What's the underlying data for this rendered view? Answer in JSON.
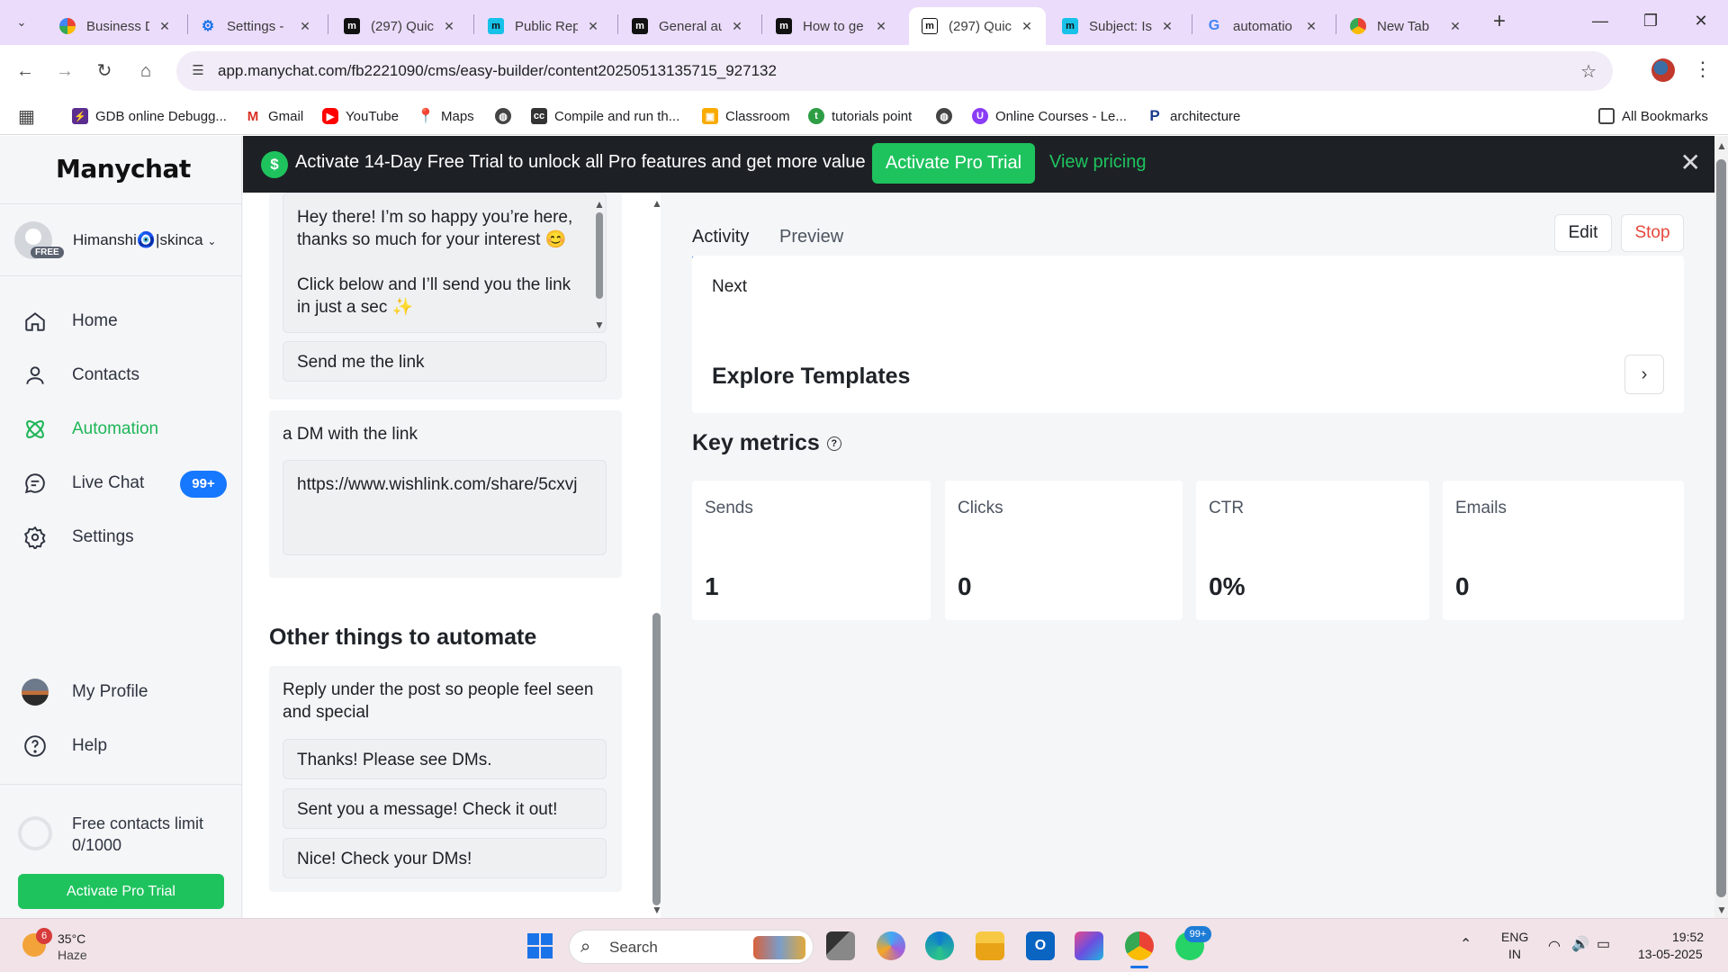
{
  "browser": {
    "tabs": [
      {
        "title": "Business D",
        "icon": "business-icon"
      },
      {
        "title": "Settings - ",
        "icon": "settings-gear-icon"
      },
      {
        "title": "(297) Quic",
        "icon": "manychat-icon"
      },
      {
        "title": "Public Rep",
        "icon": "manychat-icon"
      },
      {
        "title": "General au",
        "icon": "manychat-icon"
      },
      {
        "title": "How to ge",
        "icon": "manychat-icon"
      },
      {
        "title": "(297) Quic",
        "icon": "manychat-icon",
        "active": true
      },
      {
        "title": "Subject: Is",
        "icon": "manychat-icon"
      },
      {
        "title": "automatio",
        "icon": "google-icon"
      },
      {
        "title": "New Tab",
        "icon": "chrome-icon"
      }
    ],
    "url": "app.manychat.com/fb2221090/cms/easy-builder/content20250513135715_927132",
    "bookmarks": [
      {
        "label": "GDB online Debugg...",
        "icon": "gdb-icon"
      },
      {
        "label": "Gmail",
        "icon": "gmail-icon"
      },
      {
        "label": "YouTube",
        "icon": "youtube-icon"
      },
      {
        "label": "Maps",
        "icon": "maps-icon"
      },
      {
        "label": "",
        "icon": "globe-icon"
      },
      {
        "label": "Compile and run th...",
        "icon": "compile-icon"
      },
      {
        "label": "Classroom",
        "icon": "classroom-icon"
      },
      {
        "label": "tutorials point",
        "icon": "tutorialspoint-icon"
      },
      {
        "label": "",
        "icon": "globe-icon"
      },
      {
        "label": "Online Courses - Le...",
        "icon": "udemy-icon"
      },
      {
        "label": "architecture",
        "icon": "pinterest-icon"
      }
    ],
    "all_bookmarks": "All Bookmarks"
  },
  "sidebar": {
    "logo": "Manychat",
    "account": {
      "name": "Himanshi🧿|skinca",
      "plan": "FREE"
    },
    "nav": [
      {
        "label": "Home",
        "icon": "home-icon"
      },
      {
        "label": "Contacts",
        "icon": "contacts-icon"
      },
      {
        "label": "Automation",
        "icon": "automation-icon",
        "active": true
      },
      {
        "label": "Live Chat",
        "icon": "live-chat-icon",
        "badge": "99+"
      },
      {
        "label": "Settings",
        "icon": "settings-icon"
      }
    ],
    "bottom_nav": [
      {
        "label": "My Profile",
        "icon": "profile-avatar"
      },
      {
        "label": "Help",
        "icon": "help-icon"
      }
    ],
    "usage": {
      "label": "Free contacts limit",
      "value": "0/1000"
    },
    "cta": "Activate Pro Trial"
  },
  "banner": {
    "message": "Activate 14-Day Free Trial to unlock all Pro features and get more value",
    "cta": "Activate Pro Trial",
    "link": "View pricing"
  },
  "builder": {
    "opening_message": "Hey there! I’m so happy you’re here, thanks so much for your interest 😊\n\nClick below and I’ll send you the link in just a sec ✨",
    "opening_button": "Send me the link",
    "dm_title": "a DM with the link",
    "dm_link": "https://www.wishlink.com/share/5cxvj",
    "other_heading": "Other things to automate",
    "reply_title": "Reply under the post so people feel seen and special",
    "replies": [
      "Thanks! Please see DMs.",
      "Sent you a message! Check it out!",
      "Nice! Check your DMs!"
    ]
  },
  "panel": {
    "tabs": [
      "Activity",
      "Preview"
    ],
    "active_tab": "Activity",
    "edit": "Edit",
    "stop": "Stop",
    "next": "Next",
    "templates": "Explore Templates",
    "metrics_title": "Key metrics",
    "metrics": [
      {
        "label": "Sends",
        "value": "1"
      },
      {
        "label": "Clicks",
        "value": "0"
      },
      {
        "label": "CTR",
        "value": "0%"
      },
      {
        "label": "Emails",
        "value": "0"
      }
    ]
  },
  "taskbar": {
    "weather": {
      "temp": "35°C",
      "condition": "Haze",
      "badge": "6"
    },
    "search": "Search",
    "whatsapp_badge": "99+",
    "lang": "ENG",
    "region": "IN",
    "time": "19:52",
    "date": "13-05-2025"
  },
  "colors": {
    "accent": "#1fc35e",
    "banner": "#1d2126",
    "stop": "#e5483b",
    "tab_strip": "#ebdcfb"
  }
}
